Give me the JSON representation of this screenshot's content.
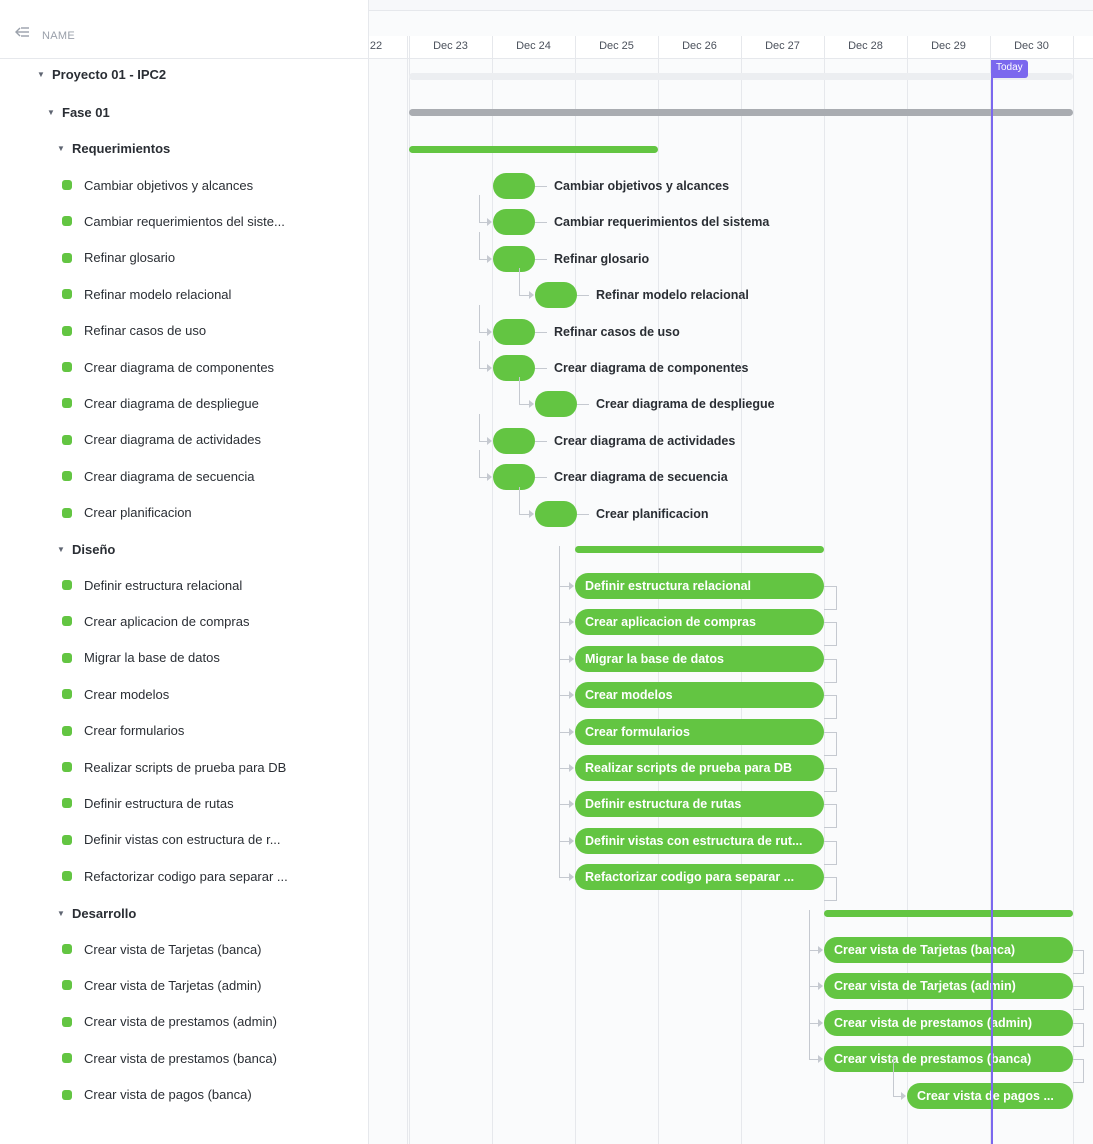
{
  "header": {
    "name_column": "NAME",
    "days": [
      "22",
      "Dec 23",
      "Dec 24",
      "Dec 25",
      "Dec 26",
      "Dec 27",
      "Dec 28",
      "Dec 29",
      "Dec 30"
    ],
    "today_label": "Today"
  },
  "project": {
    "name": "Proyecto 01 - IPC2"
  },
  "phase": {
    "name": "Fase 01"
  },
  "groups": {
    "requerimientos": {
      "name": "Requerimientos",
      "tasks": [
        "Cambiar objetivos y alcances",
        "Cambiar requerimientos del siste...",
        "Refinar glosario",
        "Refinar modelo relacional",
        "Refinar casos de uso",
        "Crear diagrama de componentes",
        "Crear diagrama de despliegue",
        "Crear diagrama de actividades",
        "Crear diagrama de secuencia",
        "Crear planificacion"
      ],
      "bar_labels": [
        "Cambiar objetivos y alcances",
        "Cambiar requerimientos del sistema",
        "Refinar glosario",
        "Refinar modelo relacional",
        "Refinar casos de uso",
        "Crear diagrama de componentes",
        "Crear diagrama de despliegue",
        "Crear diagrama de actividades",
        "Crear diagrama de secuencia",
        "Crear planificacion"
      ]
    },
    "diseno": {
      "name": "Diseño",
      "tasks": [
        "Definir estructura relacional",
        "Crear aplicacion de compras",
        "Migrar la base de datos",
        "Crear modelos",
        "Crear formularios",
        "Realizar scripts de prueba para DB",
        "Definir estructura de rutas",
        "Definir vistas con estructura de r...",
        "Refactorizar codigo para separar ..."
      ],
      "bar_labels": [
        "Definir estructura relacional",
        "Crear aplicacion de compras",
        "Migrar la base de datos",
        "Crear modelos",
        "Crear formularios",
        "Realizar scripts de prueba para DB",
        "Definir estructura de rutas",
        "Definir vistas con estructura de rut...",
        "Refactorizar codigo para separar ..."
      ]
    },
    "desarrollo": {
      "name": "Desarrollo",
      "tasks": [
        "Crear vista de Tarjetas (banca)",
        "Crear vista de Tarjetas (admin)",
        "Crear vista de prestamos (admin)",
        "Crear vista de prestamos (banca)",
        "Crear vista de pagos (banca)"
      ],
      "bar_labels": [
        "Crear vista de Tarjetas (banca)",
        "Crear vista de Tarjetas (admin)",
        "Crear vista de prestamos (admin)",
        "Crear vista de prestamos (banca)",
        "Crear vista de pagos ..."
      ]
    }
  },
  "colors": {
    "task_green": "#63c542",
    "phase_gray": "#a9acb1",
    "today_purple": "#7b68ee"
  }
}
